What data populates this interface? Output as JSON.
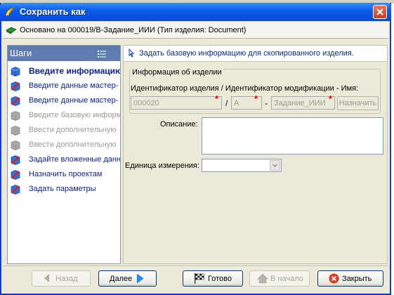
{
  "window": {
    "title": "Сохранить как",
    "based_on": "Основано на 000019/B-Задание_ИИИ (Тип изделия: Document)"
  },
  "steps_panel": {
    "title": "Шаги",
    "items": [
      {
        "label": "Введите информацию",
        "state": "active"
      },
      {
        "label": "Введите данные мастер-",
        "state": "normal"
      },
      {
        "label": "Введите данные мастер-",
        "state": "normal"
      },
      {
        "label": "Введите базовую информ",
        "state": "disabled"
      },
      {
        "label": "Ввести дополнительную",
        "state": "disabled"
      },
      {
        "label": "Ввести дополнительную",
        "state": "disabled"
      },
      {
        "label": "Задайте вложенные данн",
        "state": "normal"
      },
      {
        "label": "Назначить проектам",
        "state": "normal"
      },
      {
        "label": "Задать параметры",
        "state": "normal"
      }
    ]
  },
  "content": {
    "hint": "Задать базовую информацию для скопированного изделия.",
    "group_title": "Информация об изделии",
    "id_label": "Идентификатор изделия / Идентификатор модификации - Имя:",
    "id_value": "000020",
    "revision_value": "A",
    "name_value": "Задание_ИИИ",
    "separator_slash": "/",
    "separator_dash": "-",
    "assign_button": "Назначить",
    "description_label": "Описание:",
    "description_value": "",
    "unit_label": "Единица измерения:",
    "unit_value": ""
  },
  "buttons": {
    "back": "Назад",
    "next": "Далее",
    "finish": "Готово",
    "start": "В начало",
    "close": "Закрыть"
  },
  "colors": {
    "titlebar": "#0a4fd8",
    "steps_header": "#5e7cb0",
    "step_text": "#0a1e8c",
    "required_marker": "#e00000"
  }
}
